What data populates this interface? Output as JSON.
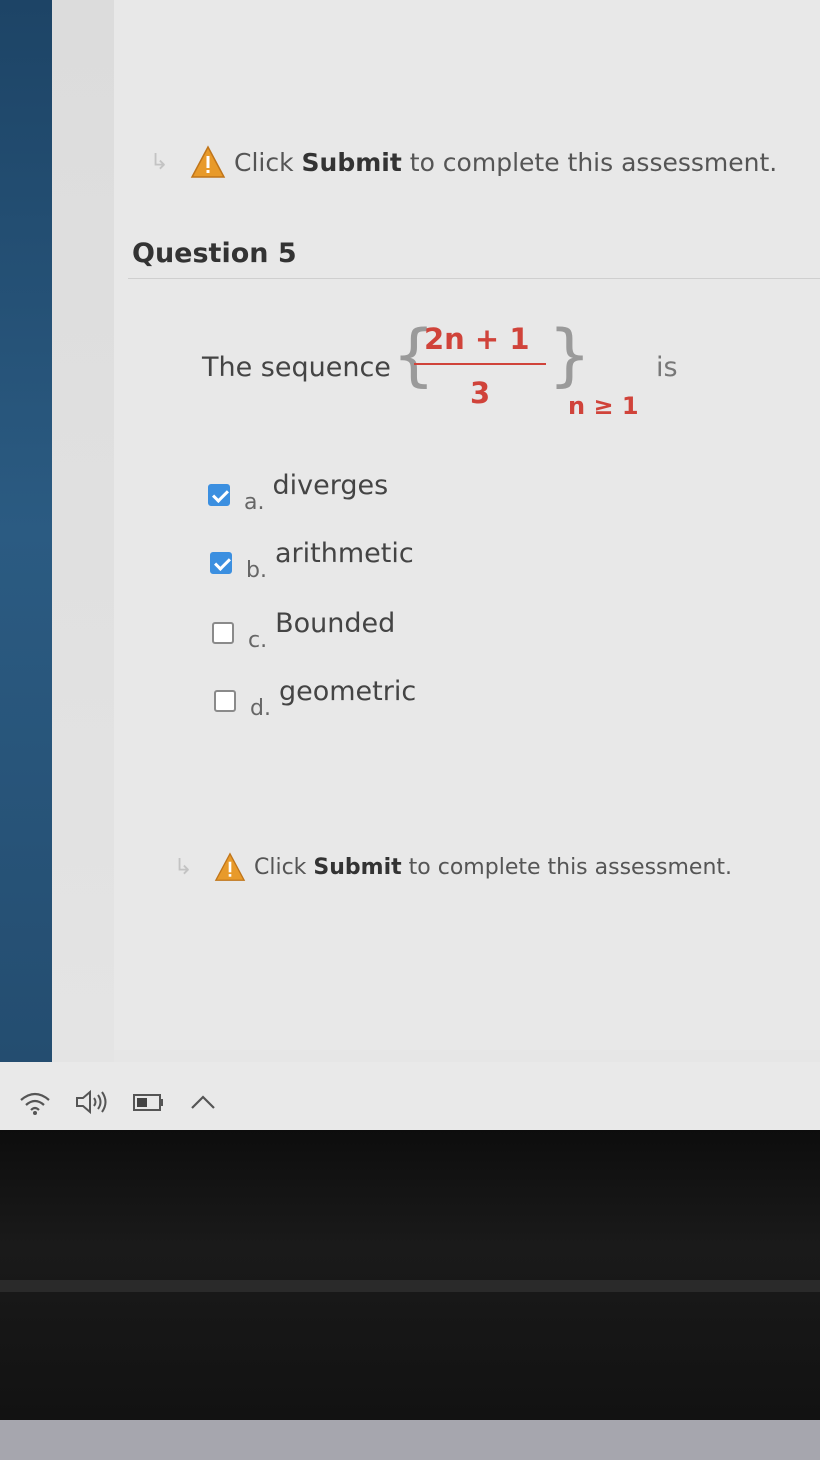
{
  "notice_top": {
    "prefix": "Click",
    "bold": "Submit",
    "suffix": "to complete this assessment."
  },
  "notice_bottom": {
    "prefix": "Click",
    "bold": "Submit",
    "suffix": "to complete this assessment."
  },
  "question": {
    "title": "Question 5",
    "stem_prefix": "The sequence",
    "numerator": "2n + 1",
    "denominator": "3",
    "subscript": "n ≥ 1",
    "stem_suffix": "is"
  },
  "options": [
    {
      "letter": "a.",
      "text": "diverges",
      "checked": true
    },
    {
      "letter": "b.",
      "text": "arithmetic",
      "checked": true
    },
    {
      "letter": "c.",
      "text": "Bounded",
      "checked": false
    },
    {
      "letter": "d.",
      "text": "geometric",
      "checked": false
    }
  ],
  "tray": {
    "icons": [
      "wifi-icon",
      "volume-icon",
      "battery-icon",
      "chevron-up-icon"
    ]
  },
  "colors": {
    "accent": "#3b8fe0",
    "math": "#d0433a",
    "warning": "#e89a2a"
  }
}
